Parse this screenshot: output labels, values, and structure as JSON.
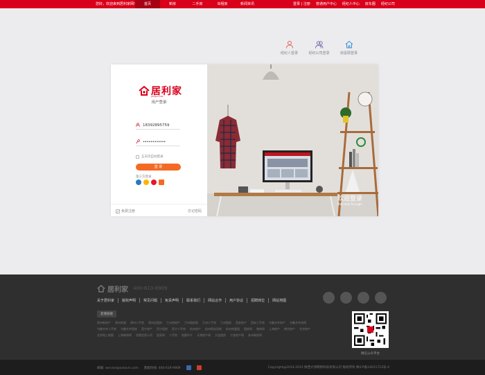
{
  "topbar": {
    "welcome": "您好，欢迎来到居利家网!",
    "nav": [
      "首页",
      "新房",
      "二手房",
      "出租房",
      "新闻资讯"
    ],
    "right": [
      "登录 | 注册",
      "普通用户中心",
      "经纪人中心",
      "房东圈",
      "经纪公司"
    ]
  },
  "roles": [
    "经纪人登录",
    "经纪公司登录",
    "房屋顾登录"
  ],
  "login": {
    "logo_text": "居利家",
    "logo_sub": "JULIJIA.COM",
    "subtitle": "用户登录",
    "phone": "18392895759",
    "password": "••••••••••••",
    "remember": "五天内自动登录",
    "button": "登 录",
    "third_party": "第三方登录",
    "register": "免费注册",
    "forgot": "忘记密码"
  },
  "banner": {
    "title": "欢迎登录",
    "subtitle": "Welcome To Login"
  },
  "footer": {
    "logo_text": "居利家",
    "phone": "400-610-8909",
    "links": [
      "关于居利家",
      "版权声明",
      "常见问题",
      "免责声明",
      "联系我们",
      "网站合作",
      "用户协议",
      "招聘岗位",
      "网站地图"
    ],
    "friend_title": "友情链接",
    "friend_links": [
      "郑州新房产",
      "郑州房源",
      "郑州二手房",
      "郑州出租房",
      "兰州房地产",
      "兰州租房网",
      "兰州二手房",
      "兰州租房",
      "西安房产",
      "西安二手房",
      "乌鲁木齐房产",
      "乌鲁木齐房网",
      "乌鲁木齐二手房",
      "乌鲁木齐租房",
      "西宁房产",
      "西宁租房",
      "西宁二手房",
      "杭州房产",
      "杭州网站导航",
      "杭州房屋租",
      "租房网",
      "装修网",
      "上海房产",
      "南京房产",
      "北京房产",
      "北京网上地图",
      "上海装修网",
      "合肥信息公司",
      "居家网",
      "二手房",
      "房屋中介",
      "天津房产网",
      "大连租房",
      "宁波房产网",
      "苏州新房网"
    ],
    "qr_caption": "微信公众平台",
    "contact": "邮箱: service@xxlavin.com",
    "hotline": "客服热线: 400-619-9909",
    "copyright": "Copyright@2014-2015 陕西大领网络科技有限公司 版权所有 陕ICP备14011723号-4"
  }
}
